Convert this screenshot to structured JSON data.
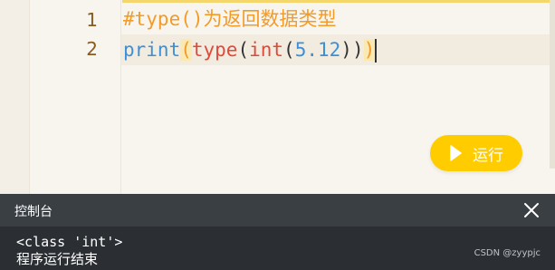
{
  "editor": {
    "line_numbers": [
      "1",
      "2"
    ],
    "line1": "#type()为返回数据类型",
    "line2": {
      "func": "print",
      "open1": "(",
      "inner_func": "type",
      "open2": "(",
      "inner2": "int",
      "open3": "(",
      "number": "5.12",
      "close3": ")",
      "close2": ")",
      "close1": ")"
    }
  },
  "run_button": {
    "label": "运行",
    "icon": "play-icon",
    "color": "#ffcc00"
  },
  "console": {
    "title": "控制台",
    "close_icon": "close-icon",
    "output": "<class 'int'>",
    "status": "程序运行结束"
  },
  "watermark": "CSDN @zyypjc"
}
